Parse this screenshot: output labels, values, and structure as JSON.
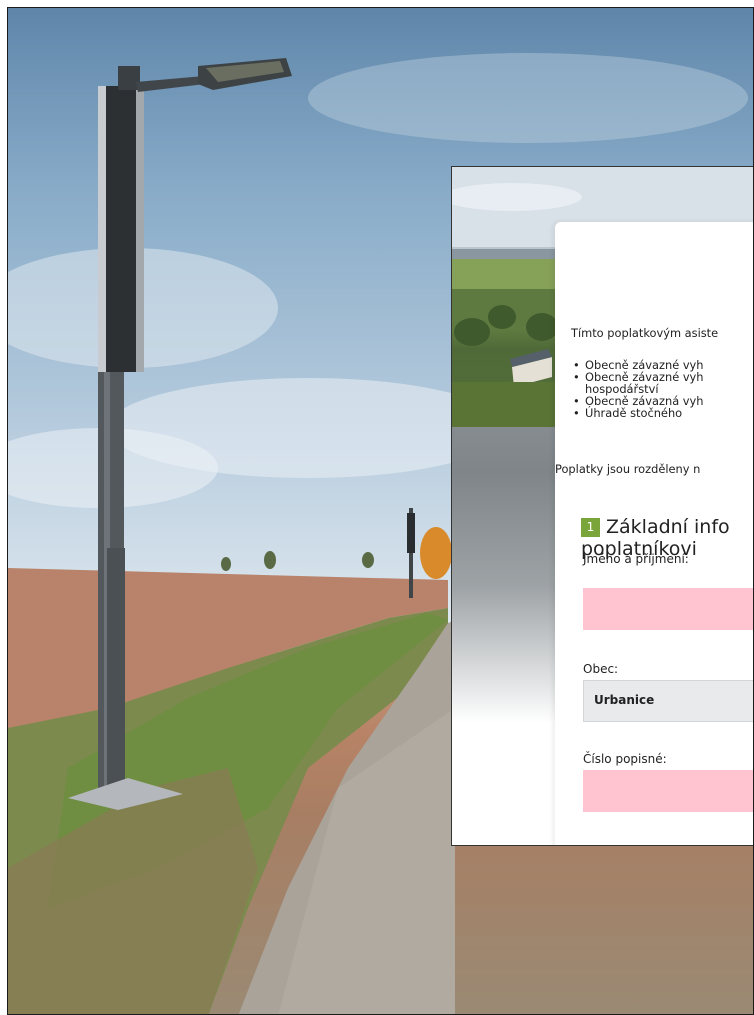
{
  "form": {
    "intro": "Tímto poplatkovým asiste",
    "bullets": [
      "Obecně závazné vyh",
      "Obecně závazné vyh",
      "Obecně závazná vyh",
      "Úhradě stočného"
    ],
    "bullet2_cont": "hospodářství",
    "poplatky_note": "Poplatky jsou rozděleny n",
    "section": {
      "number": "1",
      "title_line1": "Základní info",
      "title_line2": "poplatníkovi"
    },
    "fields": {
      "name_label": "Jméno a příjmení:",
      "name_value": "",
      "obec_label": "Obec:",
      "obec_value": "Urbanice",
      "cislo_label": "Číslo popisné:",
      "cislo_value": ""
    }
  },
  "colors": {
    "badge": "#7aa53a",
    "required_field": "#ffc4cf",
    "select_field": "#e8eaec"
  }
}
